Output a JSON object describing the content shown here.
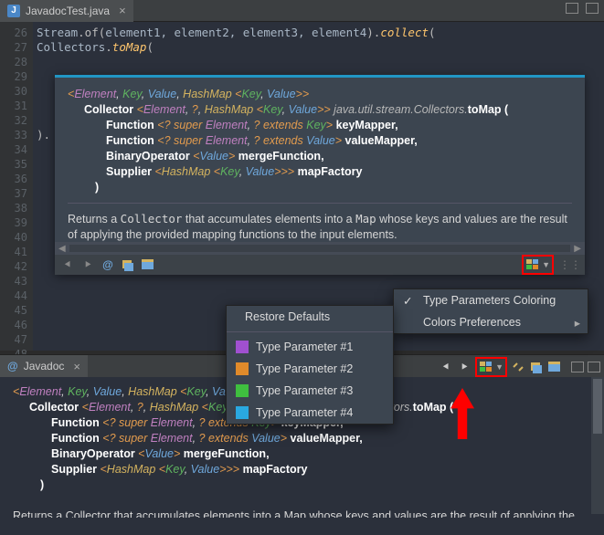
{
  "tab": {
    "filename": "JavadocTest.java",
    "icon_letter": "J"
  },
  "gutter": [
    "26",
    "27",
    "28",
    "29",
    "30",
    "31",
    "32",
    "33",
    "34",
    "35",
    "36",
    "37",
    "38",
    "39",
    "40",
    "41",
    "42",
    "43",
    "44",
    "45",
    "46",
    "47",
    "48"
  ],
  "code": {
    "l1_a": "Stream",
    "l1_b": ".of(",
    "l1_c": "element1, element2, element3, element4",
    "l1_d": ").",
    "l1_e": "collect",
    "l1_f": "(",
    "l2_a": "        Collectors",
    "l2_b": ".",
    "l2_c": "toMap",
    "l2_d": "(",
    "l8_a": ")."
  },
  "sig": {
    "tp_open": "<",
    "tp_e": "Element",
    "sep": ", ",
    "tp_k": "Key",
    "tp_v": "Value",
    "tp_h": "HashMap",
    "tp_close": ">",
    "collector": "Collector ",
    "q": "?",
    "pkg": " java.util.stream.Collectors.",
    "method": "toMap",
    " open": " (",
    "fn": "Function ",
    "sup": "? super ",
    "ext": "? extends ",
    "km": " keyMapper,",
    "vm": " valueMapper,",
    "bo": "BinaryOperator ",
    "mf": " mergeFunction,",
    "sp": "Supplier ",
    "mp": " mapFactory",
    "close": ")",
    "gg": ">> "
  },
  "desc": {
    "t1": "Returns a ",
    "c1": "Collector",
    "t2": " that accumulates elements into a ",
    "c2": "Map",
    "t3": " whose keys and values are the result of applying the provided mapping functions to the input elements."
  },
  "desc2": {
    "t": "Returns a Collector that accumulates elements into a Map whose keys and values are the result of applying the"
  },
  "menu1": {
    "i1": "Type Parameters Coloring",
    "i2": "Colors Preferences"
  },
  "menu2": {
    "h": "Restore Defaults",
    "i1": "Type Parameter #1",
    "i2": "Type Parameter #2",
    "i3": "Type Parameter #3",
    "i4": "Type Parameter #4"
  },
  "colors": {
    "p1": "#a050d0",
    "p2": "#e08a2a",
    "p3": "#3fbf3f",
    "p4": "#2aa8e0"
  },
  "jd": {
    "tab": "Javadoc",
    "icon": "@"
  }
}
